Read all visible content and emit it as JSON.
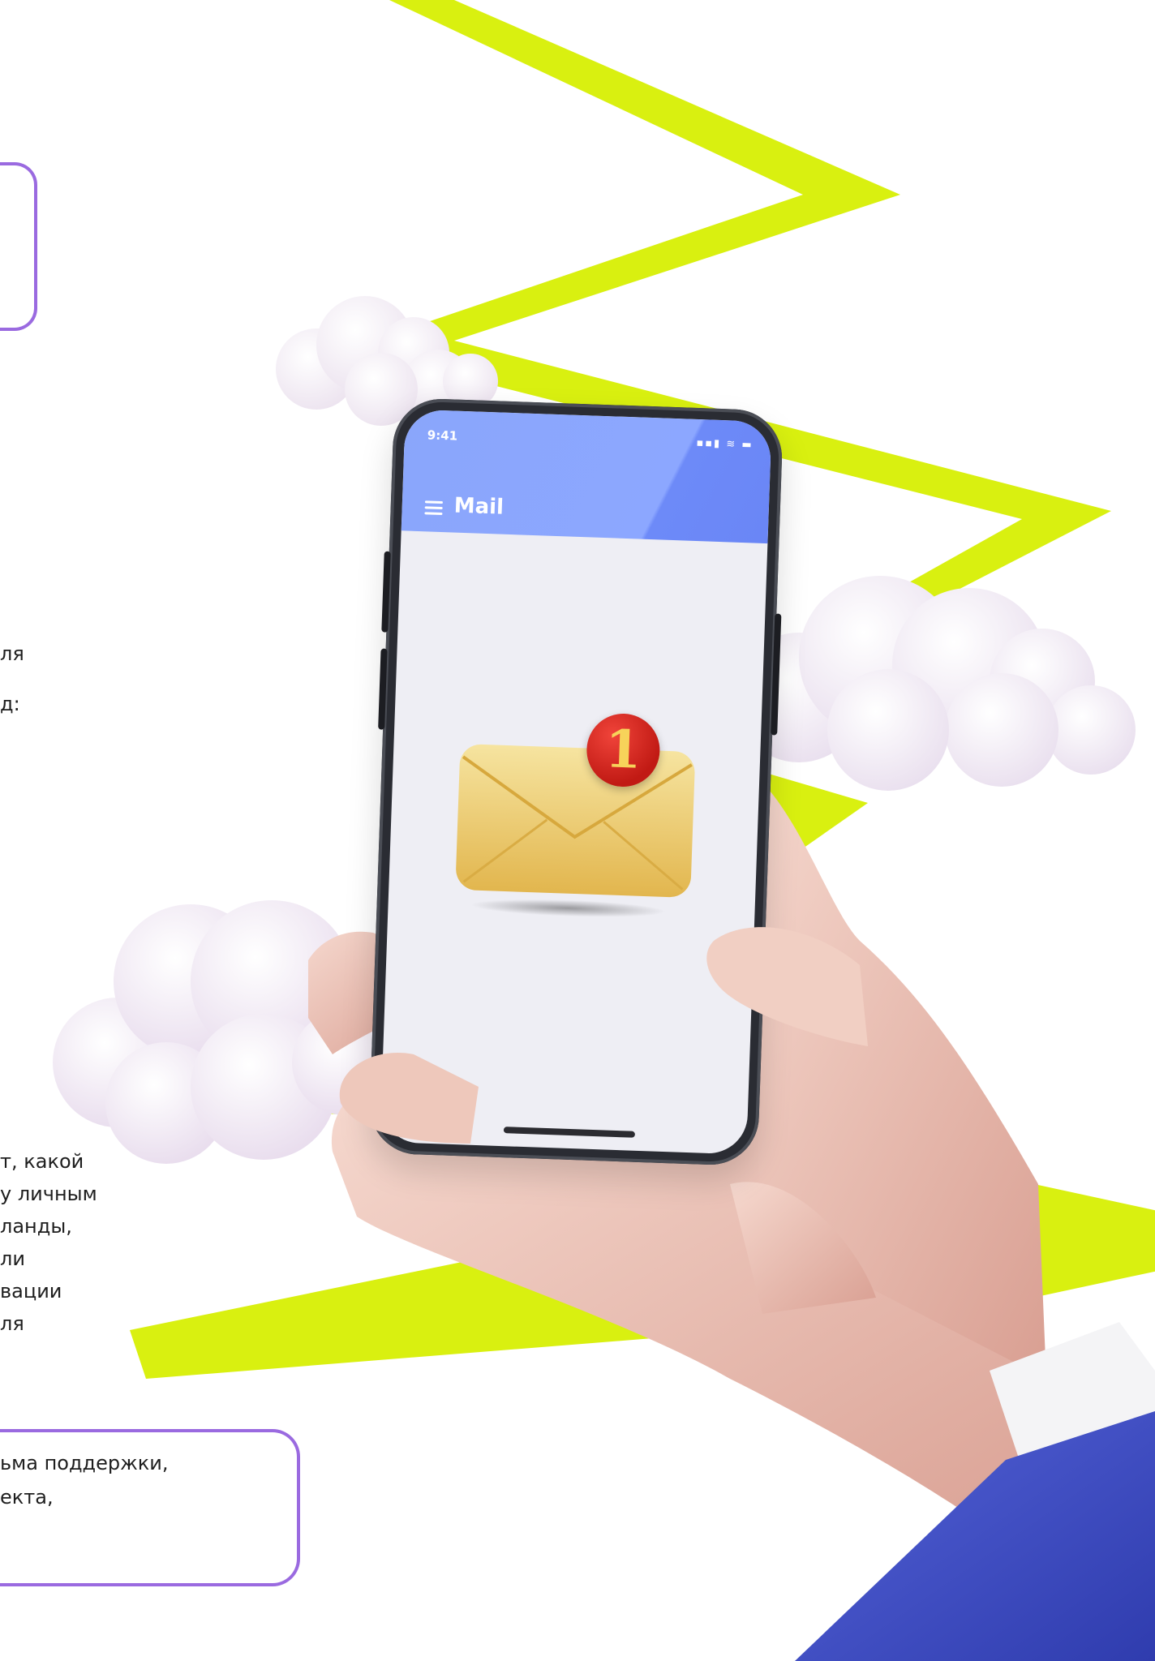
{
  "text_fragments": {
    "line_1": "ля",
    "line_2": "д:",
    "block_lines": [
      "т, какой",
      "у личным",
      "ланды,",
      "ли",
      "вации",
      "ля"
    ],
    "box_lines": [
      "ьма поддержки,",
      "екта,"
    ]
  },
  "phone": {
    "status_time": "9:41",
    "status_icons": "▪▪▮ ≋ ▬",
    "app_title": "Mail",
    "notification_count": "1"
  },
  "colors": {
    "zigzag": "#d9f010",
    "frame": "#9a6ae0",
    "header": "#8ca7ff",
    "badge": "#d42a22",
    "sleeve": "#3f4fc9"
  },
  "icons": [
    "menu-icon",
    "envelope-icon",
    "notification-badge-icon",
    "signal-icon",
    "wifi-icon",
    "battery-icon"
  ]
}
